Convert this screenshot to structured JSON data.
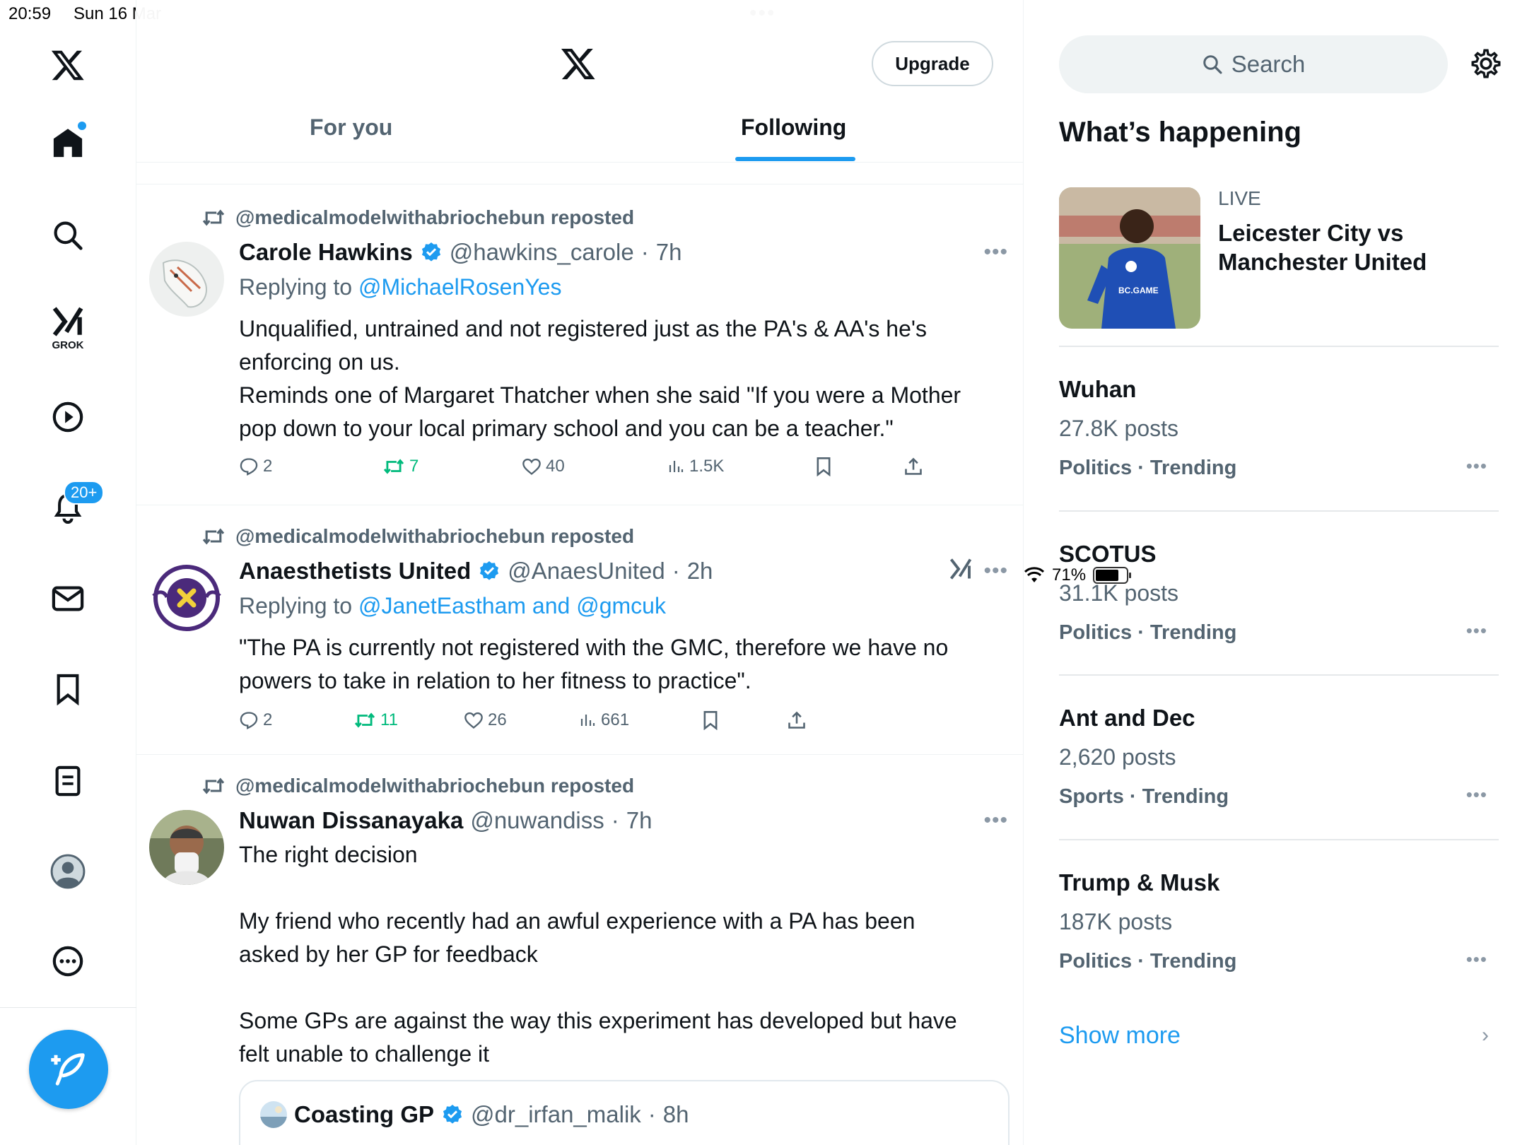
{
  "status_bar": {
    "time": "20:59",
    "date": "Sun 16 Mar",
    "battery": "71%",
    "battery_level": 0.71
  },
  "nav": {
    "grok_label": "GROK",
    "notifications_badge": "20+",
    "icons": [
      "x-logo-icon",
      "home-icon",
      "search-icon",
      "grok-icon",
      "video-icon",
      "bell-icon",
      "mail-icon",
      "bookmark-icon",
      "list-icon",
      "profile-icon",
      "more-icon",
      "compose-icon"
    ]
  },
  "header": {
    "upgrade_label": "Upgrade",
    "tabs": [
      {
        "label": "For you"
      },
      {
        "label": "Following"
      }
    ]
  },
  "posts": [
    {
      "repost_by": "@medicalmodelwithabriochebun reposted",
      "name": "Carole Hawkins",
      "handle": "@hawkins_carole",
      "time": "7h",
      "replying_prefix": "Replying to ",
      "replying_to": "@MichaelRosenYes",
      "text": "Unqualified, untrained and not registered just as the PA's & AA's he's\nenforcing on us.\nReminds one of Margaret Thatcher when she said \"If you were a Mother\npop down to your local primary school and you can be a teacher.\"",
      "replies": "2",
      "reposts": "7",
      "likes": "40",
      "views": "1.5K"
    },
    {
      "repost_by": "@medicalmodelwithabriochebun reposted",
      "name": "Anaesthetists United",
      "handle": "@AnaesUnited",
      "time": "2h",
      "replying_prefix": "Replying to ",
      "replying_to": "@JanetEastham and @gmcuk",
      "text": "\"The PA is currently not registered with the GMC, therefore we have no\npowers to take in relation to her fitness to practice\".",
      "replies": "2",
      "reposts": "11",
      "likes": "26",
      "views": "661"
    },
    {
      "repost_by": "@medicalmodelwithabriochebun reposted",
      "name": "Nuwan Dissanayaka",
      "handle": "@nuwandiss",
      "time": "7h",
      "text": "The right decision\n\nMy friend who recently had an awful experience with a PA has been\nasked by her GP for feedback\n\nSome GPs are against the way this experiment has developed but have\nfelt unable to challenge it",
      "quote": {
        "name": "Coasting GP",
        "handle": "@dr_irfan_malik",
        "time": "8h"
      }
    }
  ],
  "sidebar": {
    "search_placeholder": "Search",
    "title": "What’s happening",
    "live": {
      "label": "LIVE",
      "title": "Leicester City vs Manchester United",
      "shirt_text": "BC.GAME"
    },
    "trends": [
      {
        "name": "Wuhan",
        "posts": "27.8K posts",
        "category": "Politics · Trending"
      },
      {
        "name": "SCOTUS",
        "posts": "31.1K posts",
        "category": "Politics · Trending"
      },
      {
        "name": "Ant and Dec",
        "posts": "2,620 posts",
        "category": "Sports · Trending"
      },
      {
        "name": "Trump & Musk",
        "posts": "187K posts",
        "category": "Politics · Trending"
      }
    ],
    "show_more": "Show more"
  }
}
